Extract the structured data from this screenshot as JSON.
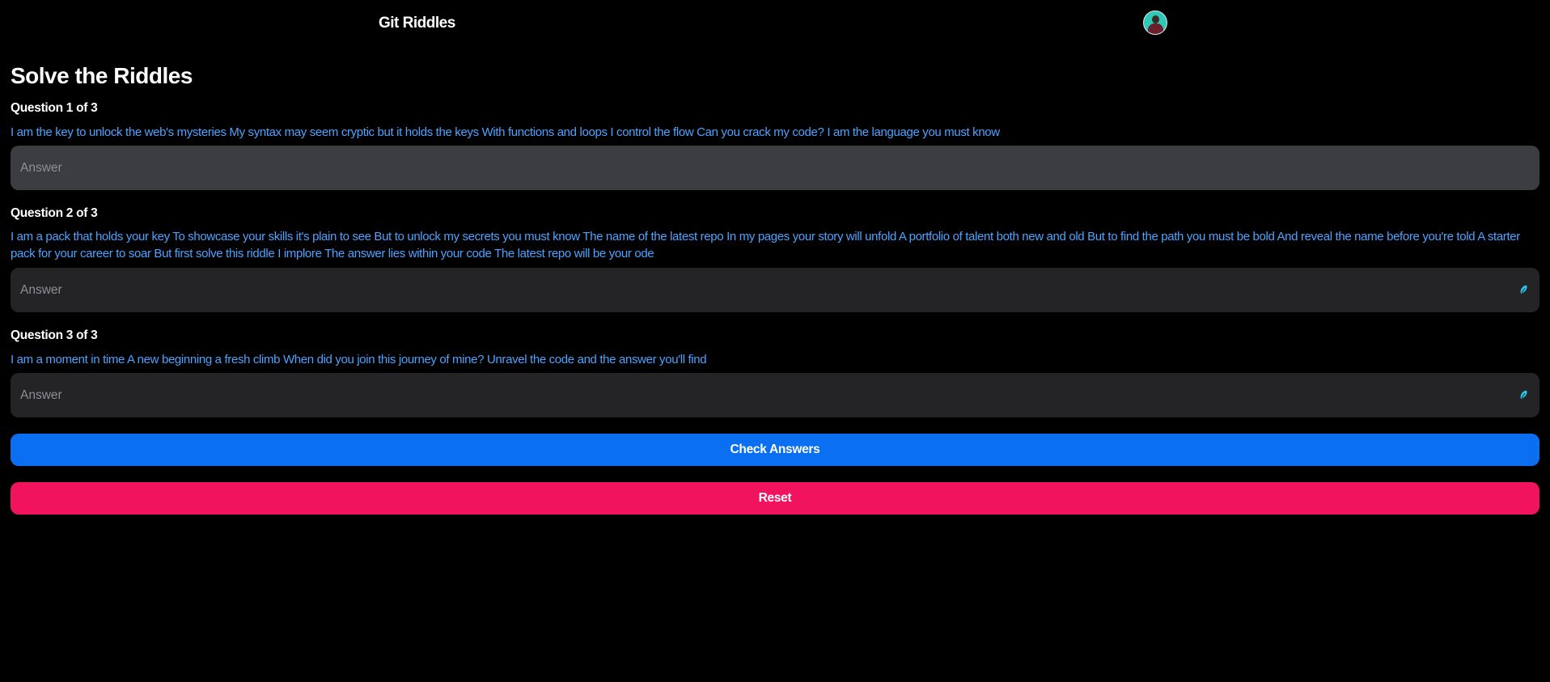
{
  "header": {
    "title": "Git Riddles",
    "avatar_icon": "user-avatar"
  },
  "main": {
    "title": "Solve the Riddles",
    "questions": [
      {
        "label": "Question 1 of 3",
        "text": "I am the key to unlock the web's mysteries My syntax may seem cryptic but it holds the keys With functions and loops I control the flow Can you crack my code? I am the language you must know",
        "placeholder": "Answer",
        "value": ""
      },
      {
        "label": "Question 2 of 3",
        "text": "I am a pack that holds your key To showcase your skills it's plain to see But to unlock my secrets you must know The name of the latest repo In my pages your story will unfold A portfolio of talent both new and old But to find the path you must be bold And reveal the name before you're told A starter pack for your career to soar But first solve this riddle I implore The answer lies within your code The latest repo will be your ode",
        "placeholder": "Answer",
        "value": ""
      },
      {
        "label": "Question 3 of 3",
        "text": "I am a moment in time A new beginning a fresh climb When did you join this journey of mine? Unravel the code and the answer you'll find",
        "placeholder": "Answer",
        "value": ""
      }
    ],
    "check_label": "Check Answers",
    "reset_label": "Reset"
  },
  "colors": {
    "background": "#000000",
    "question_text": "#4da3ff",
    "input_bg": "#242426",
    "input_focused_bg": "#3c3d41",
    "check_button": "#0a6ff0",
    "reset_button": "#f2135e",
    "autofill_icon": "#2ec7e6"
  }
}
